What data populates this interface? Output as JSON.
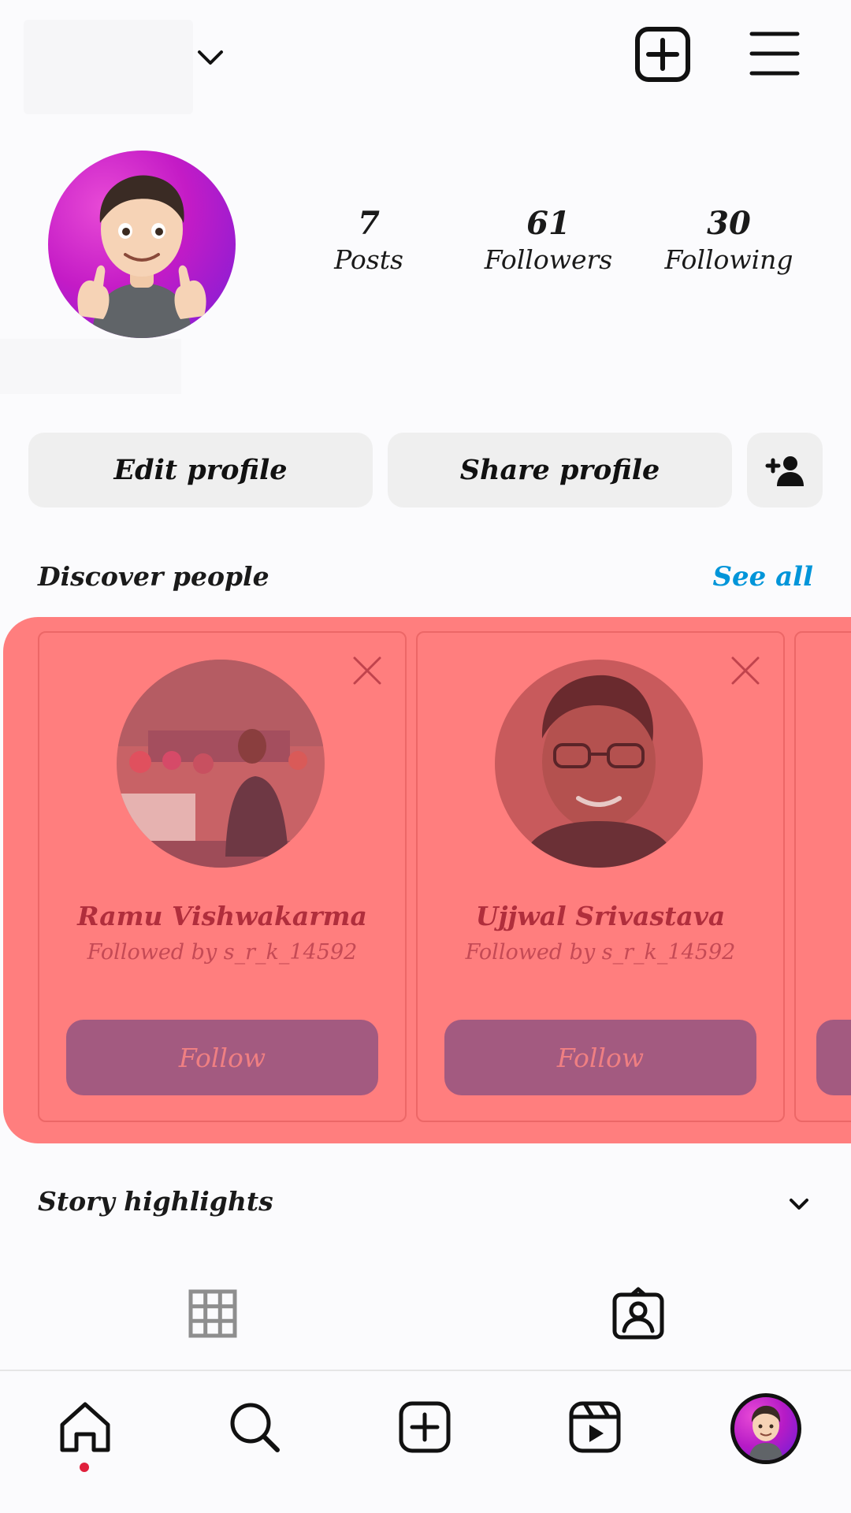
{
  "header": {
    "account_switcher_icon": "chevron-down-icon",
    "new_post_icon": "plus-square-icon",
    "menu_icon": "hamburger-menu-icon"
  },
  "profile": {
    "avatar": "avatar-thumbs-up",
    "stats": [
      {
        "value": "7",
        "label": "Posts"
      },
      {
        "value": "61",
        "label": "Followers"
      },
      {
        "value": "30",
        "label": "Following"
      }
    ]
  },
  "actions": {
    "edit_label": "Edit profile",
    "share_label": "Share profile",
    "add_person_icon": "add-person-icon"
  },
  "discover": {
    "title": "Discover people",
    "see_all": "See all",
    "cards": [
      {
        "name": "Ramu Vishwakarma",
        "subtitle": "Followed by s_r_k_14592",
        "button": "Follow"
      },
      {
        "name": "Ujjwal Srivastava",
        "subtitle": "Followed by s_r_k_14592",
        "button": "Follow"
      }
    ]
  },
  "highlights": {
    "title": "Story highlights"
  },
  "tabs": [
    "grid-icon",
    "tagged-icon"
  ],
  "nav": [
    "home-icon",
    "search-icon",
    "create-icon",
    "reels-icon",
    "profile-avatar"
  ],
  "colors": {
    "see_all": "#0095d9",
    "overlay": "#ff7e7e",
    "follow_button": "#a35a80",
    "notification_dot": "#e0203c"
  }
}
